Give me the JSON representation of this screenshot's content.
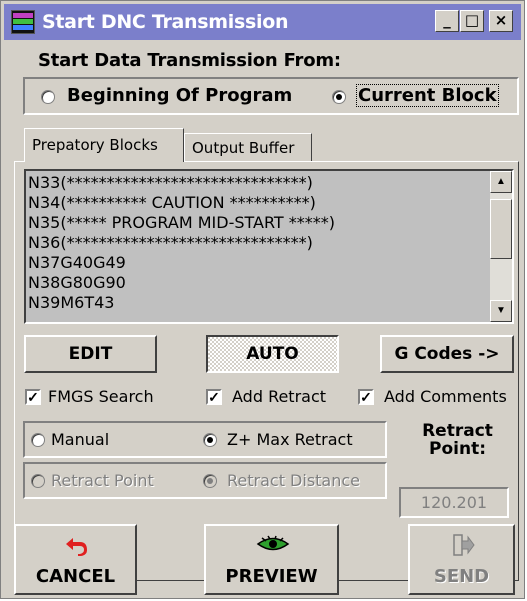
{
  "window": {
    "title": "Start DNC Transmission",
    "app_icon": "vero-data-vision-icon",
    "controls": {
      "minimize": "_",
      "maximize": "□",
      "close": "×"
    }
  },
  "start_from": {
    "heading": "Start Data Transmission From:",
    "options": [
      "Beginning Of Program",
      "Current Block"
    ],
    "selected": "Current Block"
  },
  "tabs": [
    {
      "label": "Prepatory Blocks",
      "active": true
    },
    {
      "label": "Output Buffer",
      "active": false
    }
  ],
  "blocks": [
    "N33(******************************)",
    "N34(********** CAUTION **********)",
    "N35(***** PROGRAM MID-START *****)",
    "N36(******************************)",
    "N37G40G49",
    "N38G80G90",
    "N39M6T43"
  ],
  "buttons": {
    "edit": "EDIT",
    "auto": "AUTO",
    "gcodes": "G Codes ->",
    "cancel": "CANCEL",
    "preview": "PREVIEW",
    "send": "SEND"
  },
  "checks": [
    {
      "label": "FMGS Search",
      "checked": true
    },
    {
      "label": "Add Retract",
      "checked": true
    },
    {
      "label": "Add Comments",
      "checked": true
    }
  ],
  "retract_mode": {
    "options": [
      "Manual",
      "Z+ Max Retract"
    ],
    "selected": "Z+ Max Retract"
  },
  "retract_type": {
    "options": [
      "Retract Point",
      "Retract Distance"
    ],
    "selected": "Retract Distance",
    "disabled": true
  },
  "retract_point": {
    "label": "Retract Point:",
    "value": "120.201"
  },
  "colors": {
    "titlebar": "#7b7fcb",
    "face": "#d4d0c8",
    "cancel_icon": "#e02020",
    "preview_icon": "#2ea02e"
  }
}
